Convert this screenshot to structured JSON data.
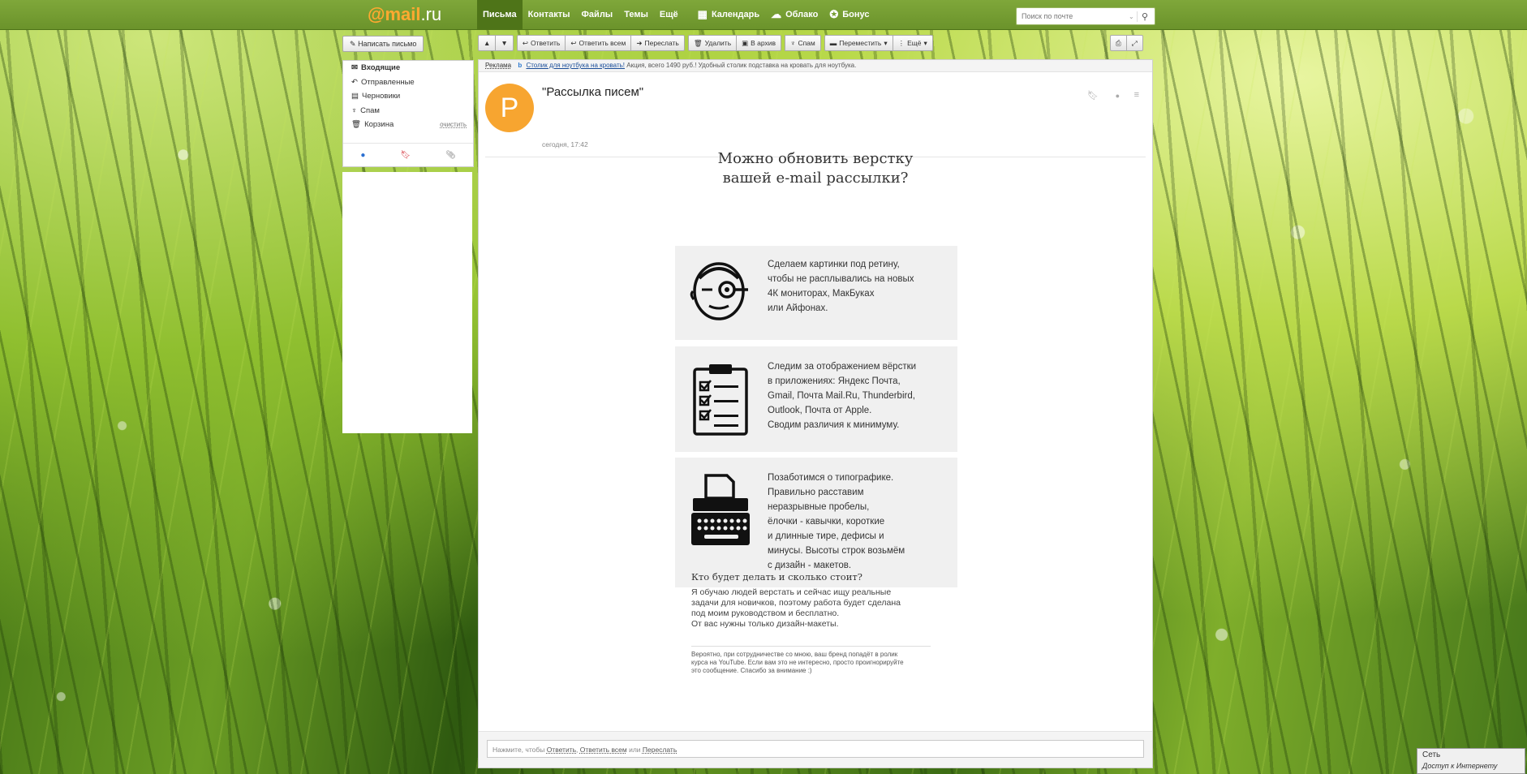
{
  "logo": {
    "at": "@",
    "brand": "mail",
    "dot": ".",
    "tld": "ru"
  },
  "nav": [
    {
      "label": "Письма",
      "active": true
    },
    {
      "label": "Контакты"
    },
    {
      "label": "Файлы"
    },
    {
      "label": "Темы"
    },
    {
      "label": "Ещё"
    },
    {
      "label": "Календарь",
      "icon": "calendar-icon"
    },
    {
      "label": "Облако",
      "icon": "cloud-icon"
    },
    {
      "label": "Бонус",
      "icon": "bonus-icon"
    }
  ],
  "search": {
    "placeholder": "Поиск по почте"
  },
  "sidebar": {
    "compose_label": "Написать письмо",
    "folders": [
      {
        "label": "Входящие",
        "icon": "inbox-icon"
      },
      {
        "label": "Отправленные",
        "icon": "sent-icon"
      },
      {
        "label": "Черновики",
        "icon": "drafts-icon"
      },
      {
        "label": "Спам",
        "icon": "spam-icon"
      },
      {
        "label": "Корзина",
        "icon": "trash-icon",
        "action": "очистить"
      }
    ]
  },
  "toolbar": {
    "reply": "Ответить",
    "reply_all": "Ответить всем",
    "forward": "Переслать",
    "delete": "Удалить",
    "archive": "В архив",
    "spam": "Спам",
    "move": "Переместить",
    "more": "Ещё"
  },
  "ad": {
    "tag": "Реклама",
    "link": "Столик для ноутбука на кровать!",
    "text": "Акция, всего 1490 руб.! Удобный столик подставка на кровать для ноутбука."
  },
  "message": {
    "avatar_letter": "P",
    "subject": "\"Рассылка писем\"",
    "date": "сегодня, 17:42",
    "headline": "Можно обновить верстку\nвашей e-mail рассылки?",
    "cards": [
      {
        "icon": "winking-face-icon",
        "text": "Сделаем картинки под ретину,\nчтобы не расплывались на новых\n4К мониторах, МакБуках\nили Айфонах."
      },
      {
        "icon": "checklist-icon",
        "text": "Следим за отображением вёрстки\nв приложениях: Яндекс Почта,\nGmail, Почта Mail.Ru, Thunderbird,\nOutlook, Почта от Apple.\nСводим различия к минимуму."
      },
      {
        "icon": "typewriter-icon",
        "text": "Позаботимся о типографике.\nПравильно расставим\nнеразрывные пробелы,\nёлочки - кавычки, короткие\nи длинные тире, дефисы и\nминусы. Высоты строк возьмём\nс дизайн - макетов."
      }
    ],
    "question": "Кто будет делать и сколько стоит?",
    "question_text": "Я обучаю людей верстать и сейчас ищу реальные\nзадачи для новичков, поэтому работа будет сделана\nпод моим руководством и бесплатно.\nОт вас нужны только дизайн-макеты.",
    "note": "Вероятно, при сотрудничестве со мною, ваш бренд попадёт в ролик\nкурса на YouTube. Если вам это не интересно, просто проигнорируйте\nэто сообщение. Спасибо за внимание :)"
  },
  "replybar": {
    "prefix": "Нажмите, чтобы ",
    "reply": "Ответить",
    "sep1": ", ",
    "reply_all": "Ответить всем",
    "sep2": " или ",
    "forward": "Переслать"
  },
  "tray": {
    "line1": "Сеть",
    "line2": "Доступ к Интернету"
  },
  "colors": {
    "topbar": "#7fa73a",
    "accent": "#ffa930",
    "avatar": "#f7a530",
    "card_bg": "#f0f0f0"
  }
}
